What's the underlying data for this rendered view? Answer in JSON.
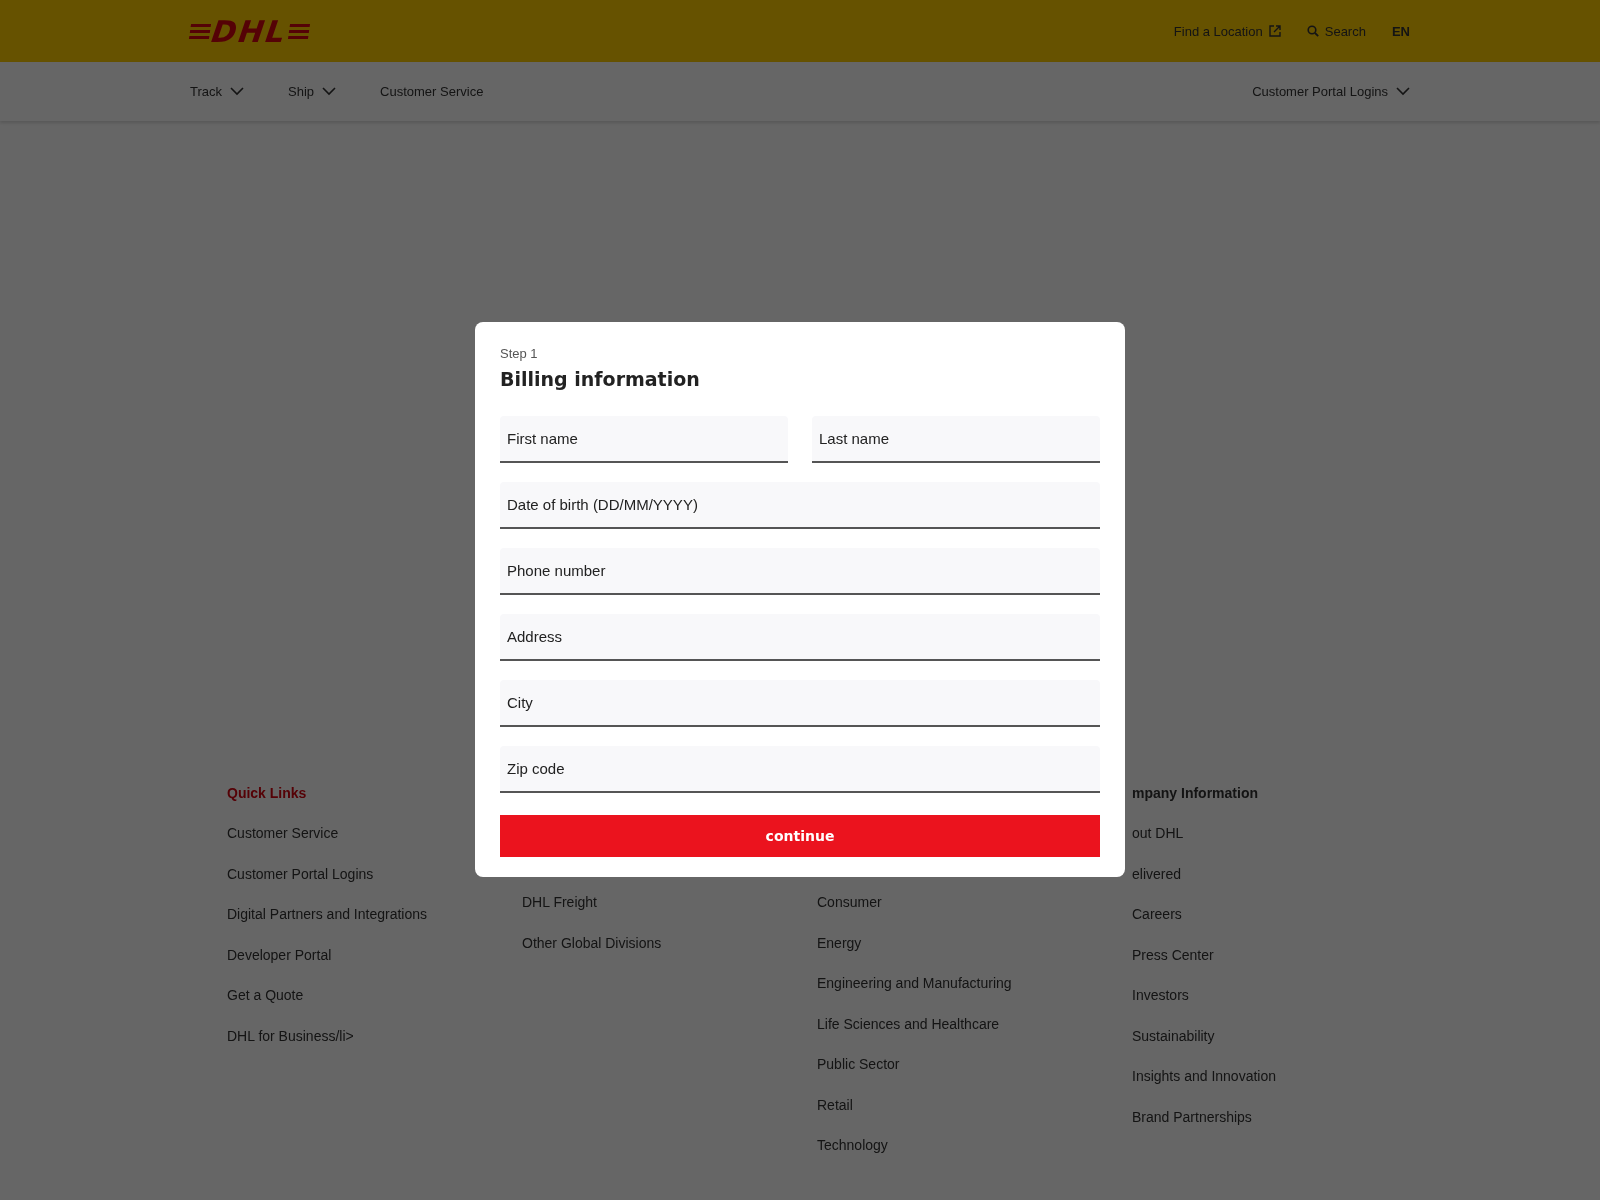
{
  "header": {
    "logo": "DHL",
    "links": [
      {
        "label": "Find a Location",
        "kind": "external"
      },
      {
        "label": "Search",
        "kind": "search"
      }
    ],
    "language": "EN"
  },
  "nav": {
    "items": [
      {
        "label": "Track",
        "dropdown": true
      },
      {
        "label": "Ship",
        "dropdown": true
      },
      {
        "label": "Customer Service",
        "dropdown": false
      }
    ],
    "right": {
      "label": "Customer Portal Logins",
      "dropdown": true
    }
  },
  "footer": {
    "columns": [
      {
        "heading": "Quick Links",
        "accent": true,
        "items": [
          "Customer Service",
          "Customer Portal Logins",
          "Digital Partners and Integrations",
          "Developer Portal",
          "Get a Quote",
          "DHL for Business/li>"
        ]
      },
      {
        "items": [
          "DHL Freight",
          "Other Global Divisions"
        ]
      },
      {
        "items": [
          "Consumer",
          "Energy",
          "Engineering and Manufacturing",
          "Life Sciences and Healthcare",
          "Public Sector",
          "Retail",
          "Technology"
        ]
      },
      {
        "heading": "mpany Information",
        "accent": false,
        "items": [
          "out DHL",
          "elivered",
          "Careers",
          "Press Center",
          "Investors",
          "Sustainability",
          "Insights and Innovation",
          "Brand Partnerships"
        ]
      }
    ]
  },
  "modal": {
    "step": "Step 1",
    "title": "Billing information",
    "rows": [
      [
        {
          "placeholder": "First name"
        },
        {
          "placeholder": "Last name"
        }
      ],
      [
        {
          "placeholder": "Date of birth (DD/MM/YYYY)"
        }
      ],
      [
        {
          "placeholder": "Phone number"
        }
      ],
      [
        {
          "placeholder": "Address"
        }
      ],
      [
        {
          "placeholder": "City"
        }
      ],
      [
        {
          "placeholder": "Zip code"
        }
      ]
    ],
    "button": "continue"
  }
}
